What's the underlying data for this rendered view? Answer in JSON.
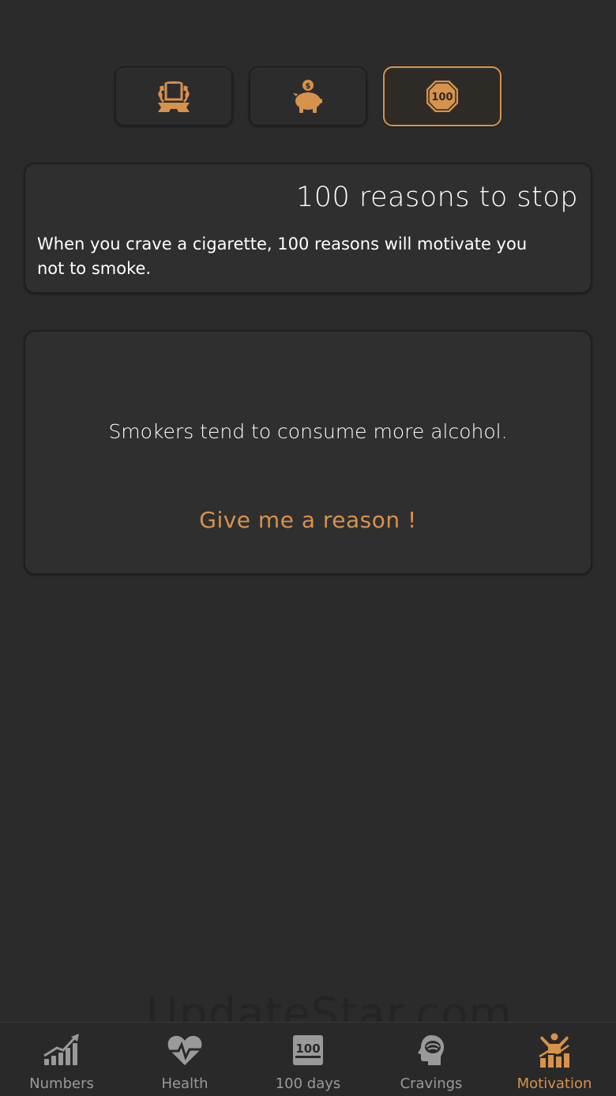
{
  "segments": [
    {
      "icon": "laurel-medal-icon",
      "selected": false
    },
    {
      "icon": "piggy-bank-icon",
      "selected": false
    },
    {
      "icon": "hundred-badge-icon",
      "icon_text": "100",
      "selected": true
    }
  ],
  "info_card": {
    "title": "100 reasons to stop",
    "description": "When you crave a cigarette, 100 reasons will motivate you not to smoke."
  },
  "reason_card": {
    "reason": "Smokers tend to consume more alcohol.",
    "button_label": "Give me a reason !"
  },
  "watermark": "UpdateStar.com",
  "tabbar": {
    "tabs": [
      {
        "label": "Numbers",
        "icon": "chart-up-icon",
        "active": false
      },
      {
        "label": "Health",
        "icon": "heart-pulse-icon",
        "active": false
      },
      {
        "label": "100 days",
        "icon": "hundred-box-icon",
        "icon_text": "100",
        "active": false
      },
      {
        "label": "Cravings",
        "icon": "head-brain-icon",
        "active": false
      },
      {
        "label": "Motivation",
        "icon": "person-cheer-chart-icon",
        "active": true
      }
    ]
  },
  "colors": {
    "background": "#2b2b2c",
    "card": "#2f2f30",
    "accent": "#d7924c",
    "inactive": "#9a9a9b"
  }
}
